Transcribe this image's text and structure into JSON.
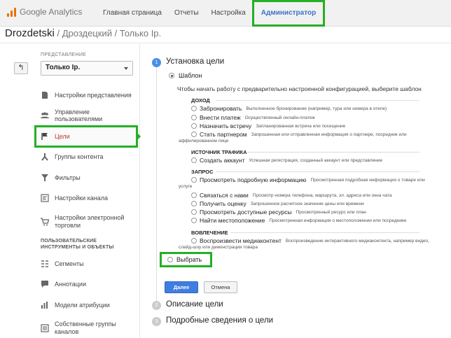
{
  "header": {
    "logo": "Google Analytics",
    "nav": [
      {
        "label": "Главная страница"
      },
      {
        "label": "Отчеты"
      },
      {
        "label": "Настройка"
      },
      {
        "label": "Администратор"
      }
    ]
  },
  "title": {
    "account": "Drozdetski",
    "path": " / Дроздецкий / Только Ip."
  },
  "sidebar": {
    "back_icon": "back-arrow-icon",
    "view_label": "ПРЕДСТАВЛЕНИЕ",
    "view_value": "Только Ip.",
    "items": [
      {
        "label": "Настройки представления",
        "icon": "document-icon"
      },
      {
        "label": "Управление пользователями",
        "icon": "users-icon"
      },
      {
        "label": "Цели",
        "icon": "flag-icon"
      },
      {
        "label": "Группы контента",
        "icon": "content-group-icon"
      },
      {
        "label": "Фильтры",
        "icon": "filter-icon"
      },
      {
        "label": "Настройки канала",
        "icon": "channel-icon"
      },
      {
        "label": "Настройки электронной торговли",
        "icon": "cart-icon"
      }
    ],
    "section_head_1": "ПОЛЬЗОВАТЕЛЬСКИЕ",
    "section_head_2": "ИНСТРУМЕНТЫ И ОБЪЕКТЫ",
    "items2": [
      {
        "label": "Сегменты",
        "icon": "segments-icon"
      },
      {
        "label": "Аннотации",
        "icon": "annotation-icon"
      },
      {
        "label": "Модели атрибуции",
        "icon": "bar-chart-icon"
      },
      {
        "label": "Собственные группы каналов",
        "icon": "channel-group-icon"
      }
    ]
  },
  "main": {
    "steps": [
      {
        "num": "1",
        "title": "Установка цели"
      },
      {
        "num": "2",
        "title": "Описание цели"
      },
      {
        "num": "3",
        "title": "Подробные сведения о цели"
      }
    ],
    "template_label": "Шаблон",
    "intro": "Чтобы начать работу с предварительно настроенной конфигурацией, выберите шаблон",
    "categories": {
      "income": "ДОХОД",
      "traffic": "ИСТОЧНИК ТРАФИКА",
      "request": "ЗАПРОС",
      "engagement": "ВОВЛЕЧЕНИЕ"
    },
    "options": {
      "reserve": {
        "label": "Забронировать",
        "desc": "Выполненное бронирование (например, тура или номера в отеле)"
      },
      "pay": {
        "label": "Внести платеж",
        "desc": "Осуществленный онлайн-платеж"
      },
      "meet": {
        "label": "Назначить встречу",
        "desc": "Запланированная встреча или посещение"
      },
      "partner": {
        "label": "Стать партнером",
        "desc": "Запрошенная или отправленная информация о партнере, посредник или",
        "desc2": "аффилированном лице"
      },
      "account": {
        "label": "Создать аккаунт",
        "desc": "Успешная регистрация, созданный аккаунт или представление"
      },
      "info": {
        "label": "Просмотреть подробную информацию",
        "desc": "Просмотренная подробная информация о товаре или",
        "desc2": "услуге"
      },
      "contact": {
        "label": "Связаться с нами",
        "desc": "Просмотр номера телефона, маршрута, эл. адреса или окна чата"
      },
      "quote": {
        "label": "Получить оценку",
        "desc": "Запрошенное расчетное значение цены или времени"
      },
      "resources": {
        "label": "Просмотреть доступные ресурсы",
        "desc": "Просмотренный ресурс или план"
      },
      "location": {
        "label": "Найти местоположение",
        "desc": "Просмотренная информация о местоположении или посреднике"
      },
      "media": {
        "label": "Воспроизвести медиаконтент",
        "desc": "Воспроизведение интерактивного медиаконтента, например видео,",
        "desc2": "слайд-шоу или демонстрации товара"
      }
    },
    "choose_label": "Выбрать",
    "done_label": "Далее",
    "cancel_label": "Отмена"
  },
  "colors": {
    "accent": "#3b73c7",
    "highlight": "#23b023",
    "selected_text": "#c0392b",
    "button_primary": "#3f7ee0"
  }
}
